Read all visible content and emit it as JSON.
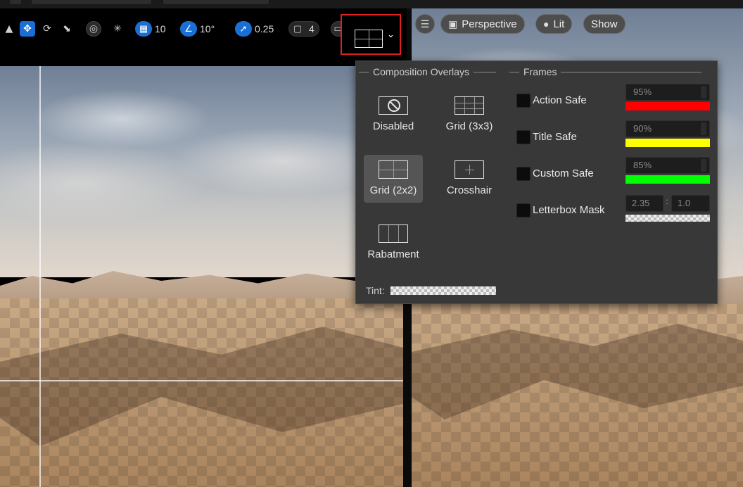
{
  "toolbar": {
    "grid_snap_value": "10",
    "rotation_snap_value": "10°",
    "scale_snap_value": "0.25",
    "camera_speed_value": "4",
    "composition_overlay_icon": "grid-2x2-icon"
  },
  "viewport_toolbar": {
    "perspective_label": "Perspective",
    "lit_label": "Lit",
    "show_label": "Show"
  },
  "composition_popup": {
    "overlays_title": "Composition Overlays",
    "frames_title": "Frames",
    "overlays": [
      {
        "label": "Disabled",
        "icon": "disabled-icon"
      },
      {
        "label": "Grid (3x3)",
        "icon": "grid-3x3-icon"
      },
      {
        "label": "Grid (2x2)",
        "icon": "grid-2x2-icon",
        "selected": true
      },
      {
        "label": "Crosshair",
        "icon": "crosshair-icon"
      },
      {
        "label": "Rabatment",
        "icon": "rabatment-icon"
      }
    ],
    "tint_label": "Tint:",
    "frames": [
      {
        "label": "Action Safe",
        "value": "95%",
        "color": "#ff0000"
      },
      {
        "label": "Title Safe",
        "value": "90%",
        "color": "#ffff00"
      },
      {
        "label": "Custom Safe",
        "value": "85%",
        "color": "#00ff00"
      },
      {
        "label": "Letterbox Mask",
        "aspect_width": "2.35",
        "aspect_height": "1.0"
      }
    ]
  },
  "colors": {
    "accent_blue": "#1a6fd4",
    "highlight_red": "#e0201f",
    "popup_bg": "#383838"
  }
}
